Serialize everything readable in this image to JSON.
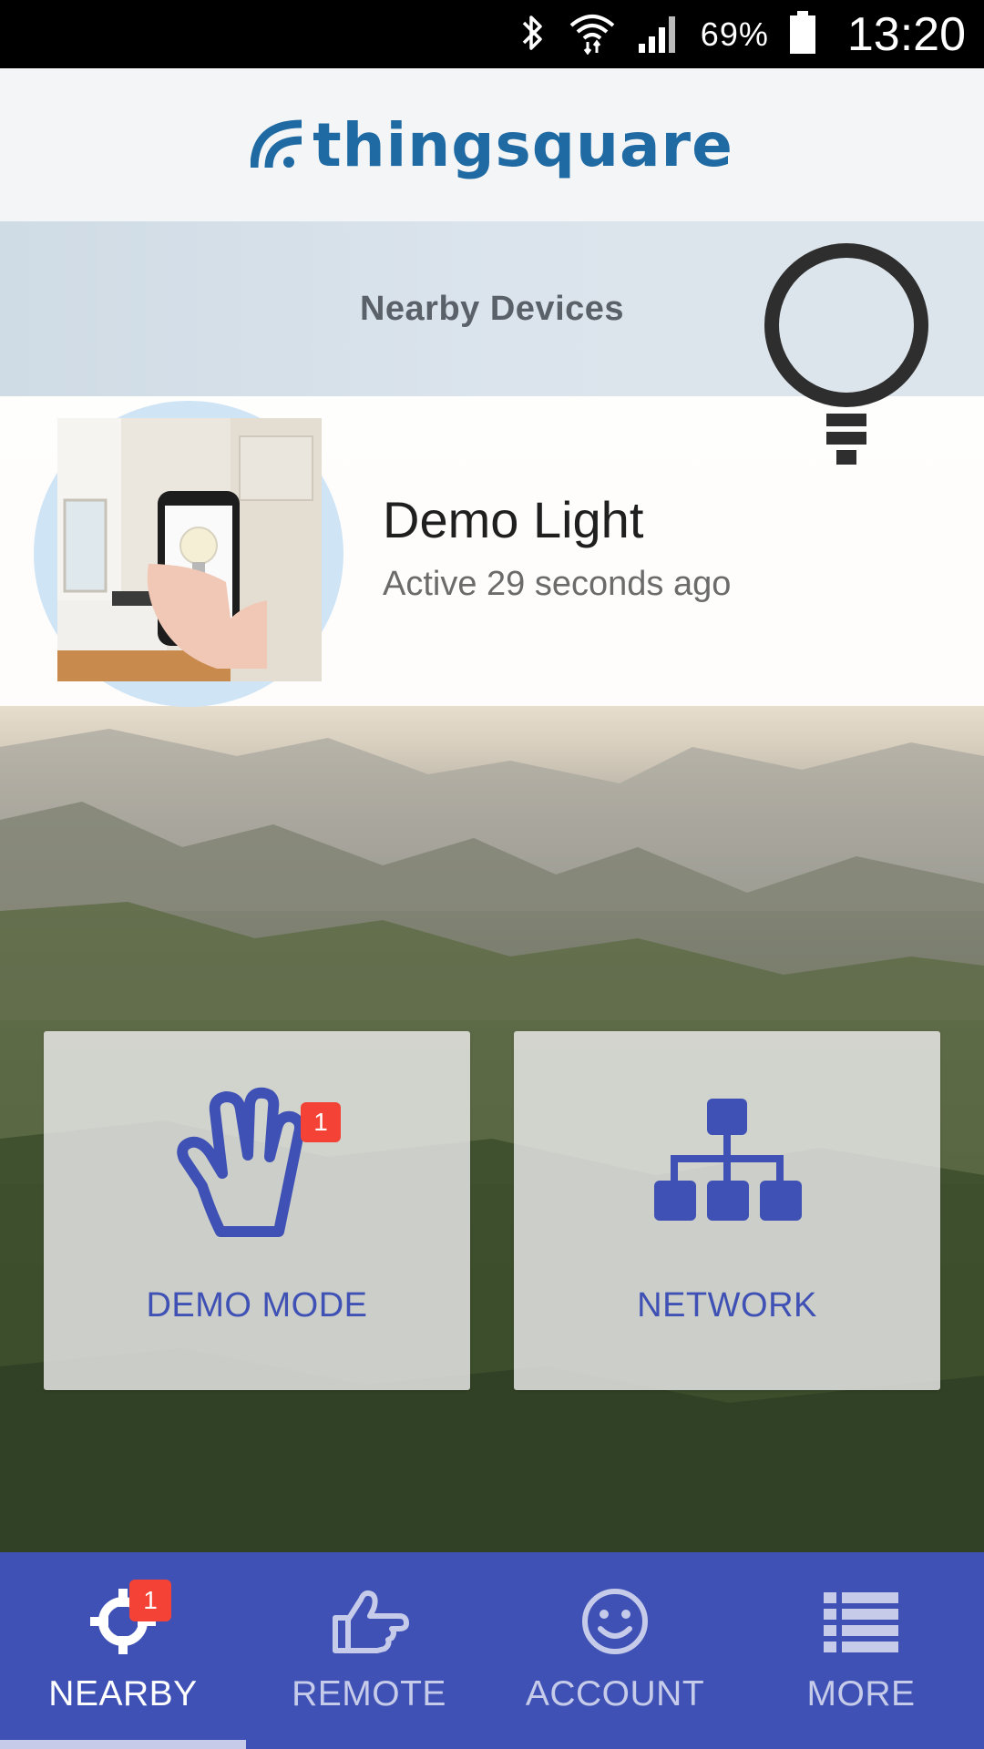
{
  "status_bar": {
    "battery_percent": "69%",
    "time": "13:20"
  },
  "header": {
    "logo_text": "thingsquare"
  },
  "nearby": {
    "title": "Nearby Devices"
  },
  "device": {
    "name": "Demo Light",
    "status": "Active 29 seconds ago"
  },
  "tiles": [
    {
      "label": "DEMO MODE",
      "icon": "hand-icon",
      "badge": "1"
    },
    {
      "label": "NETWORK",
      "icon": "network-icon"
    }
  ],
  "bottom_nav": {
    "items": [
      {
        "label": "NEARBY",
        "icon": "crosshair-icon",
        "badge": "1",
        "active": true
      },
      {
        "label": "REMOTE",
        "icon": "pointing-hand-icon"
      },
      {
        "label": "ACCOUNT",
        "icon": "smiley-icon"
      },
      {
        "label": "MORE",
        "icon": "list-icon"
      }
    ]
  },
  "colors": {
    "primary": "#3f51b5",
    "badge": "#f44336",
    "logo": "#1f6aa3"
  }
}
